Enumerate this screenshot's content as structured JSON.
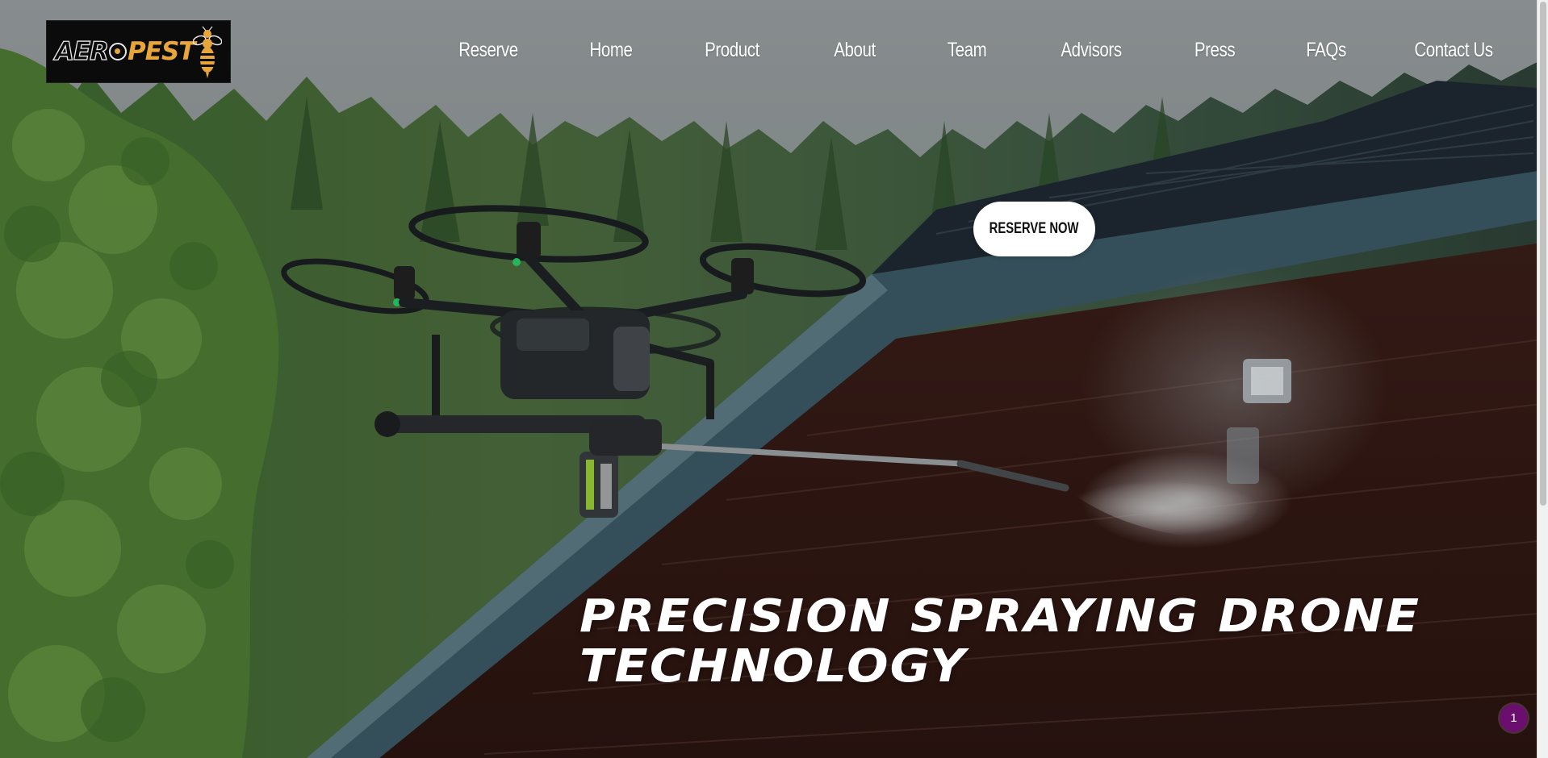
{
  "header": {
    "logo": {
      "word_part1": "AER",
      "word_part2": "PEST",
      "alt": "AEROPEST"
    },
    "nav": [
      {
        "label": "Reserve"
      },
      {
        "label": "Home"
      },
      {
        "label": "Product"
      },
      {
        "label": "About"
      },
      {
        "label": "Team"
      },
      {
        "label": "Advisors"
      },
      {
        "label": "Press"
      },
      {
        "label": "FAQs"
      },
      {
        "label": "Contact Us"
      }
    ]
  },
  "hero": {
    "cta_label": "RESERVE NOW",
    "headline_line1": "PRECISION SPRAYING DRONE",
    "headline_line2": "TECHNOLOGY"
  },
  "notification_badge": {
    "count": "1"
  },
  "colors": {
    "logo_accent": "#e8a53a",
    "badge": "#6b0f6e",
    "cta_bg": "#ffffff",
    "nav_text": "#ffffff"
  }
}
